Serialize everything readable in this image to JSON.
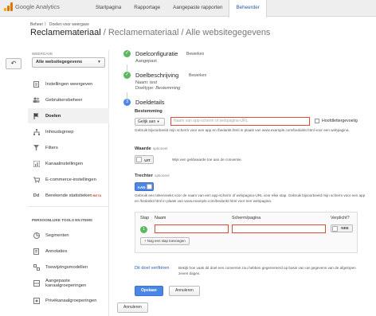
{
  "topbar": {
    "logo_text": "Google Analytics",
    "tabs": [
      "Startpagina",
      "Rapportage",
      "Aangepaste rapporten",
      "Beheerder"
    ]
  },
  "header": {
    "breadcrumb": "Beheer  〉 Doelen voor weergave",
    "title": "Reclamemateriaal",
    "title_sub": " / Reclamemateriaal / Alle websitegegevens"
  },
  "sidebar": {
    "view_label": "WEERGAVE",
    "view_value": "Alle websitegegevens",
    "items": [
      {
        "label": "Instellingen weergeven",
        "icon": "document-icon"
      },
      {
        "label": "Gebruikersbeheer",
        "icon": "users-icon"
      },
      {
        "label": "Doelen",
        "icon": "flag-icon"
      },
      {
        "label": "Inhoudsgroep",
        "icon": "hierarchy-icon"
      },
      {
        "label": "Filters",
        "icon": "filter-icon"
      },
      {
        "label": "Kanaalinstellingen",
        "icon": "channel-icon"
      },
      {
        "label": "E-commerce-instellingen",
        "icon": "cart-icon"
      },
      {
        "label": "Berekende statistieken",
        "icon": "dd-icon",
        "badge": "BETA"
      }
    ],
    "personal_label": "PERSOONLIJKE TOOLS EN ITEMS",
    "personal_items": [
      {
        "label": "Segmenten",
        "icon": "segments-icon"
      },
      {
        "label": "Annotaties",
        "icon": "annotation-icon"
      },
      {
        "label": "Toewijzingsmodellen",
        "icon": "model-icon"
      },
      {
        "label": "Aangepaste kanaalgroeperingen",
        "icon": "grouping-icon"
      },
      {
        "label": "Privékanaalgroeperingen",
        "icon": "private-grouping-icon"
      }
    ]
  },
  "goal": {
    "step1": {
      "title": "Doelconfiguratie",
      "edit": "Bewerken",
      "sub": "Aangepast"
    },
    "step2": {
      "title": "Doelbeschrijving",
      "edit": "Bewerken",
      "name_label": "Naam:",
      "name_value": "test",
      "type_label": "Doeltype:",
      "type_value": "Bestemming"
    },
    "step3": {
      "number": "3",
      "title": "Doeldetails",
      "destination_label": "Bestemming",
      "match_select": "Gelijk aan",
      "url_placeholder": "Naam van app-scherm of webpagina-URL",
      "case_label": "Hoofdlettergevoelig",
      "help_destination": "Gebruik bijvoorbeeld mijn scherm voor een app en /bedankt.html in plaats van www.example.com/bedankt.html voor een webpagina.",
      "value_label": "Waarde",
      "value_optional": "optioneel",
      "value_toggle": "UIT",
      "value_help": "Wijs een geldwaarde toe aan de conversie.",
      "funnel_label": "Trechter",
      "funnel_optional": "optioneel",
      "funnel_toggle": "AAN",
      "funnel_help": "Gebruik een tekenreeks voor de naam van een app-scherm of webpagina-URL voor elke stap. Gebruik bijvoorbeeld mijn scherm voor een app en /bedankt.html in plaats van www.example.com/bedankt.html voor een webpagina.",
      "funnel_table": {
        "col_step": "Stap",
        "col_name": "Naam",
        "col_screen": "Scherm/pagina",
        "col_required": "Verplicht?",
        "row_number": "1",
        "required_value": "NEE",
        "add_step": "+ Nog een stap toevoegen"
      },
      "verify_link": "Dit doel verifiëren",
      "verify_help": "Bekijk hoe vaak dit doel een conversie zou hebben gegenereerd op basis van uw gegevens van de afgelopen zeven dagen.",
      "save": "Opslaan",
      "cancel": "Annuleren"
    },
    "bottom_cancel": "Annuleren"
  },
  "colors": {
    "accent": "#4a86e8",
    "success": "#5cb85c",
    "error": "#dd4b39",
    "link": "#2a5db0"
  }
}
